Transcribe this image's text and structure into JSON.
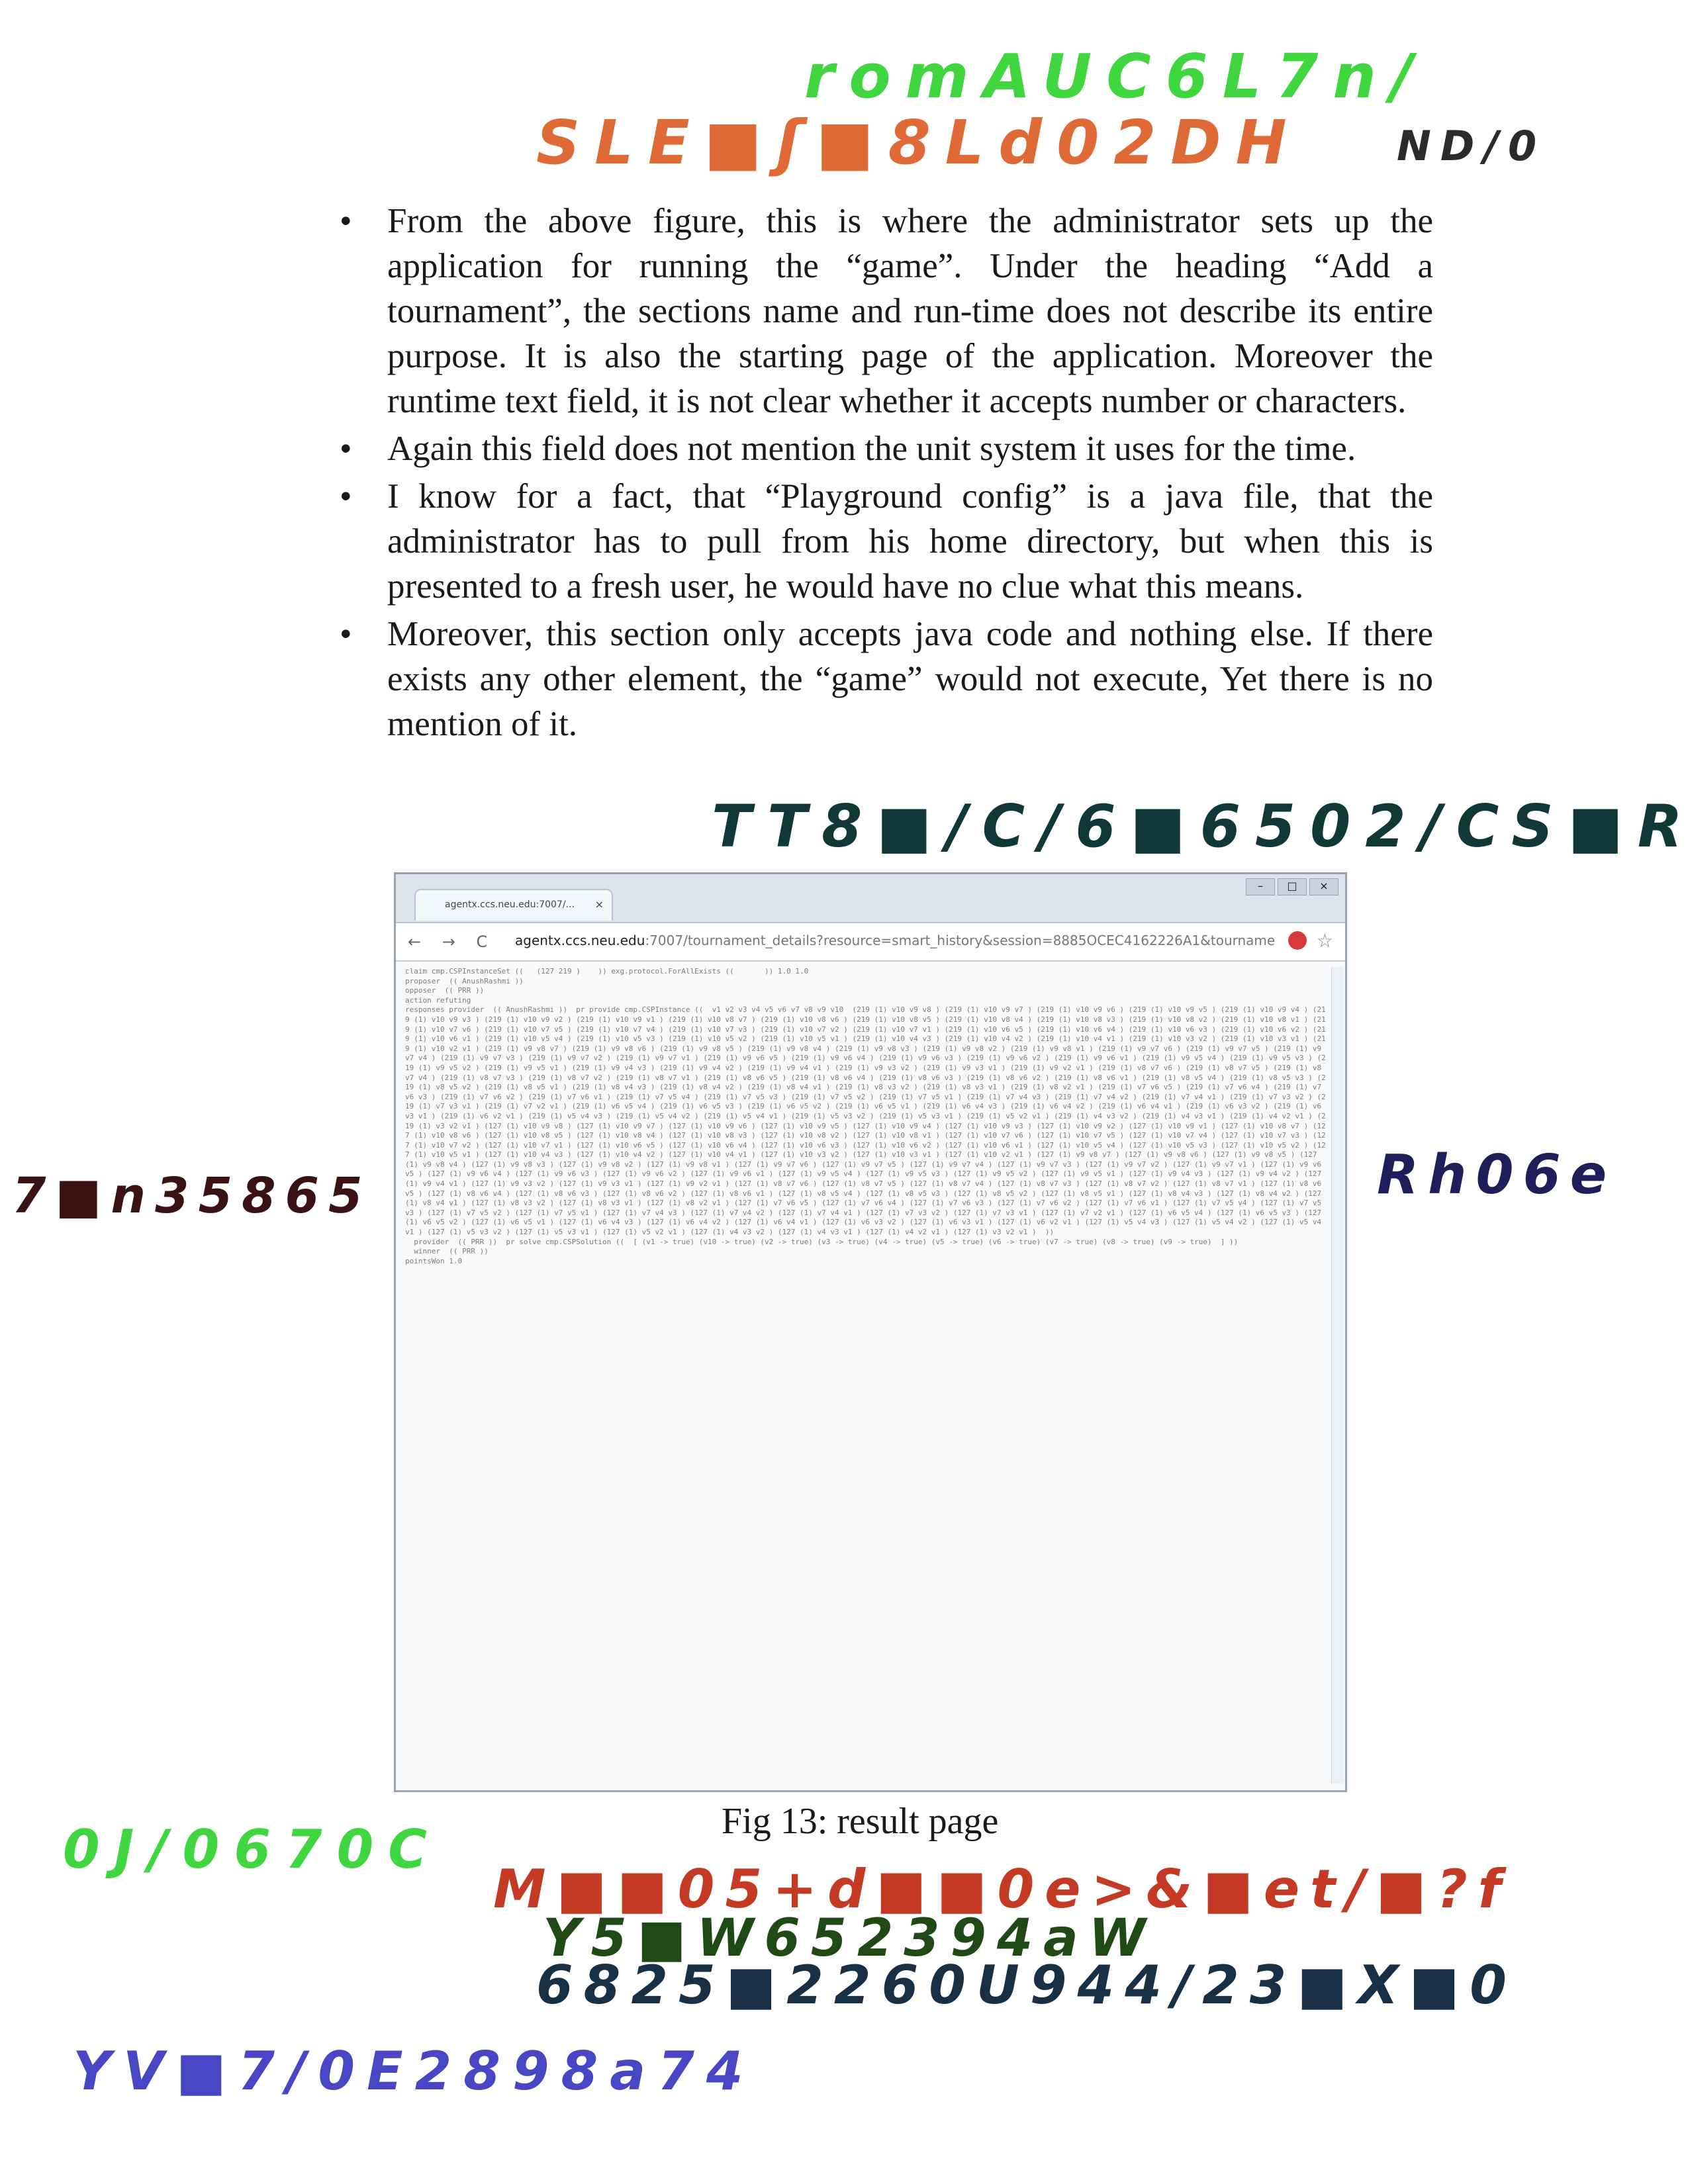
{
  "handwriting": {
    "top_green": "romAUC6L7n/",
    "top_orange": "SLE■ʃ■8Ld02DH",
    "top_right": "ND/0",
    "mid_dark": "TT8■/C/6■6502/CS■R",
    "left_dark": "7■n35865",
    "right_navy": "Rh06e",
    "bottom_green": "0J/0670C",
    "bottom_red": "M■■05+d■■0e>&■et/■?f",
    "bottom_olive": "Y5■W652394aW",
    "bottom_navy": "6825■2260U944/23■X■0",
    "bottom_blue": "YV■7/0E2898a74"
  },
  "bullets": [
    "From the above figure, this is where the administrator sets up the application for running the “game”. Under the heading “Add a tournament”, the sections name and run-time does not describe its entire purpose. It is also the starting page of the application. Moreover the runtime text field, it is not clear whether it accepts number or characters.",
    "Again this field does not mention the unit system it uses for the time.",
    "I know for a fact, that “Playground config” is a java file, that the administrator has to pull from his home directory, but when this is presented to a fresh user, he would have no clue what this means.",
    "Moreover, this section only accepts java code and nothing else. If there exists any other element, the “game” would not execute, Yet there is no mention of it."
  ],
  "bullet_symbol": "•",
  "browser": {
    "tab_title": "agentx.ccs.neu.edu:7007/...",
    "tab_close": "×",
    "nav_icons": "← → C",
    "url_host": "agentx.ccs.neu.edu",
    "url_path": ":7007/tournament_details?resource=smart_history&session=8885OCEC4162226A1&tournament",
    "window_controls": [
      "–",
      "□",
      "×"
    ],
    "star": "☆",
    "content": "claim cmp.CSPInstanceSet ((   (127 219 )    )) exg.protocol.ForAllExists ((       )) 1.0 1.0\nproposer  (( AnushRashmi ))\nopposer  (( PRR ))\naction refuting\nresponses provider  (( AnushRashmi ))  pr provide cmp.CSPInstance ((  v1 v2 v3 v4 v5 v6 v7 v8 v9 v10  (219 (1) v10 v9 v8 ) (219 (1) v10 v9 v7 ) (219 (1) v10 v9 v6 ) (219 (1) v10 v9 v5 ) (219 (1) v10 v9 v4 ) (219 (1) v10 v9 v3 ) (219 (1) v10 v9 v2 ) (219 (1) v10 v9 v1 ) (219 (1) v10 v8 v7 ) (219 (1) v10 v8 v6 ) (219 (1) v10 v8 v5 ) (219 (1) v10 v8 v4 ) (219 (1) v10 v8 v3 ) (219 (1) v10 v8 v2 ) (219 (1) v10 v8 v1 ) (219 (1) v10 v7 v6 ) (219 (1) v10 v7 v5 ) (219 (1) v10 v7 v4 ) (219 (1) v10 v7 v3 ) (219 (1) v10 v7 v2 ) (219 (1) v10 v7 v1 ) (219 (1) v10 v6 v5 ) (219 (1) v10 v6 v4 ) (219 (1) v10 v6 v3 ) (219 (1) v10 v6 v2 ) (219 (1) v10 v6 v1 ) (219 (1) v10 v5 v4 ) (219 (1) v10 v5 v3 ) (219 (1) v10 v5 v2 ) (219 (1) v10 v5 v1 ) (219 (1) v10 v4 v3 ) (219 (1) v10 v4 v2 ) (219 (1) v10 v4 v1 ) (219 (1) v10 v3 v2 ) (219 (1) v10 v3 v1 ) (219 (1) v10 v2 v1 ) (219 (1) v9 v8 v7 ) (219 (1) v9 v8 v6 ) (219 (1) v9 v8 v5 ) (219 (1) v9 v8 v4 ) (219 (1) v9 v8 v3 ) (219 (1) v9 v8 v2 ) (219 (1) v9 v8 v1 ) (219 (1) v9 v7 v6 ) (219 (1) v9 v7 v5 ) (219 (1) v9 v7 v4 ) (219 (1) v9 v7 v3 ) (219 (1) v9 v7 v2 ) (219 (1) v9 v7 v1 ) (219 (1) v9 v6 v5 ) (219 (1) v9 v6 v4 ) (219 (1) v9 v6 v3 ) (219 (1) v9 v6 v2 ) (219 (1) v9 v6 v1 ) (219 (1) v9 v5 v4 ) (219 (1) v9 v5 v3 ) (219 (1) v9 v5 v2 ) (219 (1) v9 v5 v1 ) (219 (1) v9 v4 v3 ) (219 (1) v9 v4 v2 ) (219 (1) v9 v4 v1 ) (219 (1) v9 v3 v2 ) (219 (1) v9 v3 v1 ) (219 (1) v9 v2 v1 ) (219 (1) v8 v7 v6 ) (219 (1) v8 v7 v5 ) (219 (1) v8 v7 v4 ) (219 (1) v8 v7 v3 ) (219 (1) v8 v7 v2 ) (219 (1) v8 v7 v1 ) (219 (1) v8 v6 v5 ) (219 (1) v8 v6 v4 ) (219 (1) v8 v6 v3 ) (219 (1) v8 v6 v2 ) (219 (1) v8 v6 v1 ) (219 (1) v8 v5 v4 ) (219 (1) v8 v5 v3 ) (219 (1) v8 v5 v2 ) (219 (1) v8 v5 v1 ) (219 (1) v8 v4 v3 ) (219 (1) v8 v4 v2 ) (219 (1) v8 v4 v1 ) (219 (1) v8 v3 v2 ) (219 (1) v8 v3 v1 ) (219 (1) v8 v2 v1 ) (219 (1) v7 v6 v5 ) (219 (1) v7 v6 v4 ) (219 (1) v7 v6 v3 ) (219 (1) v7 v6 v2 ) (219 (1) v7 v6 v1 ) (219 (1) v7 v5 v4 ) (219 (1) v7 v5 v3 ) (219 (1) v7 v5 v2 ) (219 (1) v7 v5 v1 ) (219 (1) v7 v4 v3 ) (219 (1) v7 v4 v2 ) (219 (1) v7 v4 v1 ) (219 (1) v7 v3 v2 ) (219 (1) v7 v3 v1 ) (219 (1) v7 v2 v1 ) (219 (1) v6 v5 v4 ) (219 (1) v6 v5 v3 ) (219 (1) v6 v5 v2 ) (219 (1) v6 v5 v1 ) (219 (1) v6 v4 v3 ) (219 (1) v6 v4 v2 ) (219 (1) v6 v4 v1 ) (219 (1) v6 v3 v2 ) (219 (1) v6 v3 v1 ) (219 (1) v6 v2 v1 ) (219 (1) v5 v4 v3 ) (219 (1) v5 v4 v2 ) (219 (1) v5 v4 v1 ) (219 (1) v5 v3 v2 ) (219 (1) v5 v3 v1 ) (219 (1) v5 v2 v1 ) (219 (1) v4 v3 v2 ) (219 (1) v4 v3 v1 ) (219 (1) v4 v2 v1 ) (219 (1) v3 v2 v1 ) (127 (1) v10 v9 v8 ) (127 (1) v10 v9 v7 ) (127 (1) v10 v9 v6 ) (127 (1) v10 v9 v5 ) (127 (1) v10 v9 v4 ) (127 (1) v10 v9 v3 ) (127 (1) v10 v9 v2 ) (127 (1) v10 v9 v1 ) (127 (1) v10 v8 v7 ) (127 (1) v10 v8 v6 ) (127 (1) v10 v8 v5 ) (127 (1) v10 v8 v4 ) (127 (1) v10 v8 v3 ) (127 (1) v10 v8 v2 ) (127 (1) v10 v8 v1 ) (127 (1) v10 v7 v6 ) (127 (1) v10 v7 v5 ) (127 (1) v10 v7 v4 ) (127 (1) v10 v7 v3 ) (127 (1) v10 v7 v2 ) (127 (1) v10 v7 v1 ) (127 (1) v10 v6 v5 ) (127 (1) v10 v6 v4 ) (127 (1) v10 v6 v3 ) (127 (1) v10 v6 v2 ) (127 (1) v10 v6 v1 ) (127 (1) v10 v5 v4 ) (127 (1) v10 v5 v3 ) (127 (1) v10 v5 v2 ) (127 (1) v10 v5 v1 ) (127 (1) v10 v4 v3 ) (127 (1) v10 v4 v2 ) (127 (1) v10 v4 v1 ) (127 (1) v10 v3 v2 ) (127 (1) v10 v3 v1 ) (127 (1) v10 v2 v1 ) (127 (1) v9 v8 v7 ) (127 (1) v9 v8 v6 ) (127 (1) v9 v8 v5 ) (127 (1) v9 v8 v4 ) (127 (1) v9 v8 v3 ) (127 (1) v9 v8 v2 ) (127 (1) v9 v8 v1 ) (127 (1) v9 v7 v6 ) (127 (1) v9 v7 v5 ) (127 (1) v9 v7 v4 ) (127 (1) v9 v7 v3 ) (127 (1) v9 v7 v2 ) (127 (1) v9 v7 v1 ) (127 (1) v9 v6 v5 ) (127 (1) v9 v6 v4 ) (127 (1) v9 v6 v3 ) (127 (1) v9 v6 v2 ) (127 (1) v9 v6 v1 ) (127 (1) v9 v5 v4 ) (127 (1) v9 v5 v3 ) (127 (1) v9 v5 v2 ) (127 (1) v9 v5 v1 ) (127 (1) v9 v4 v3 ) (127 (1) v9 v4 v2 ) (127 (1) v9 v4 v1 ) (127 (1) v9 v3 v2 ) (127 (1) v9 v3 v1 ) (127 (1) v9 v2 v1 ) (127 (1) v8 v7 v6 ) (127 (1) v8 v7 v5 ) (127 (1) v8 v7 v4 ) (127 (1) v8 v7 v3 ) (127 (1) v8 v7 v2 ) (127 (1) v8 v7 v1 ) (127 (1) v8 v6 v5 ) (127 (1) v8 v6 v4 ) (127 (1) v8 v6 v3 ) (127 (1) v8 v6 v2 ) (127 (1) v8 v6 v1 ) (127 (1) v8 v5 v4 ) (127 (1) v8 v5 v3 ) (127 (1) v8 v5 v2 ) (127 (1) v8 v5 v1 ) (127 (1) v8 v4 v3 ) (127 (1) v8 v4 v2 ) (127 (1) v8 v4 v1 ) (127 (1) v8 v3 v2 ) (127 (1) v8 v3 v1 ) (127 (1) v8 v2 v1 ) (127 (1) v7 v6 v5 ) (127 (1) v7 v6 v4 ) (127 (1) v7 v6 v3 ) (127 (1) v7 v6 v2 ) (127 (1) v7 v6 v1 ) (127 (1) v7 v5 v4 ) (127 (1) v7 v5 v3 ) (127 (1) v7 v5 v2 ) (127 (1) v7 v5 v1 ) (127 (1) v7 v4 v3 ) (127 (1) v7 v4 v2 ) (127 (1) v7 v4 v1 ) (127 (1) v7 v3 v2 ) (127 (1) v7 v3 v1 ) (127 (1) v7 v2 v1 ) (127 (1) v6 v5 v4 ) (127 (1) v6 v5 v3 ) (127 (1) v6 v5 v2 ) (127 (1) v6 v5 v1 ) (127 (1) v6 v4 v3 ) (127 (1) v6 v4 v2 ) (127 (1) v6 v4 v1 ) (127 (1) v6 v3 v2 ) (127 (1) v6 v3 v1 ) (127 (1) v6 v2 v1 ) (127 (1) v5 v4 v3 ) (127 (1) v5 v4 v2 ) (127 (1) v5 v4 v1 ) (127 (1) v5 v3 v2 ) (127 (1) v5 v3 v1 ) (127 (1) v5 v2 v1 ) (127 (1) v4 v3 v2 ) (127 (1) v4 v3 v1 ) (127 (1) v4 v2 v1 ) (127 (1) v3 v2 v1 )  ))\n  provider  (( PRR ))  pr solve cmp.CSPSolution ((  [ (v1 -> true) (v10 -> true) (v2 -> true) (v3 -> true) (v4 -> true) (v5 -> true) (v6 -> true) (v7 -> true) (v8 -> true) (v9 -> true)  ] ))\n  winner  (( PRR ))\npointsWon 1.0"
  },
  "caption": "Fig 13: result page"
}
